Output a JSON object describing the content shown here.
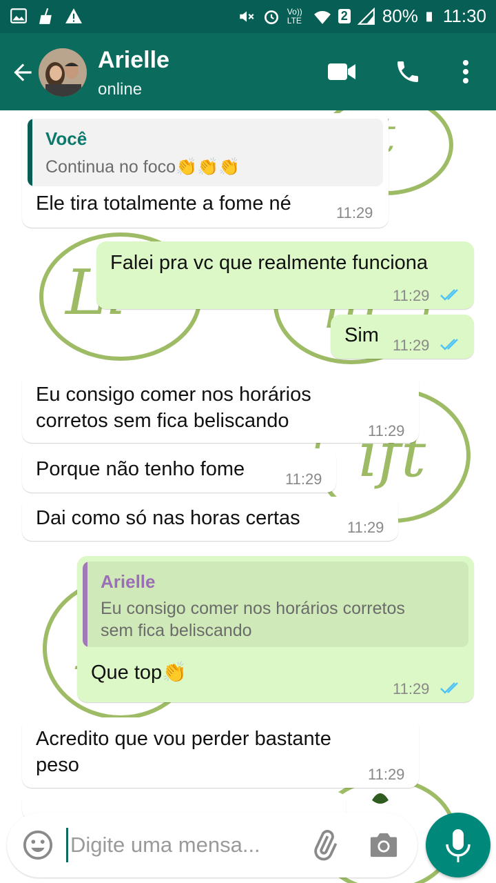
{
  "status_bar": {
    "battery": "80%",
    "time": "11:30",
    "carrier_label": "Vo)) LTE",
    "sim_badge": "2",
    "left_icons": [
      "image-icon",
      "broom-icon",
      "warning-icon"
    ],
    "right_icons": [
      "mute-icon",
      "alarm-icon",
      "wifi-icon",
      "signal-icon",
      "battery-icon"
    ]
  },
  "header": {
    "contact_name": "Arielle",
    "status": "online",
    "icons": [
      "back-arrow-icon",
      "video-call-icon",
      "phone-icon",
      "more-vert-icon"
    ]
  },
  "messages": [
    {
      "direction": "in",
      "quote": {
        "author": "Você",
        "text": "Continua no foco👏👏👏"
      },
      "lines": [
        "Ele tira totalmente a fome né"
      ],
      "time": "11:29"
    },
    {
      "direction": "out",
      "lines": [
        "Falei pra vc que realmente funciona"
      ],
      "time": "11:29",
      "status": "read"
    },
    {
      "direction": "out",
      "lines": [
        "Sim"
      ],
      "time": "11:29",
      "status": "read"
    },
    {
      "direction": "in",
      "lines": [
        "Eu consigo comer nos horários",
        "corretos sem fica beliscando"
      ],
      "time": "11:29"
    },
    {
      "direction": "in",
      "lines": [
        "Porque não tenho fome"
      ],
      "time": "11:29"
    },
    {
      "direction": "in",
      "lines": [
        "Dai como só nas horas certas"
      ],
      "time": "11:29"
    },
    {
      "direction": "out",
      "quote": {
        "author": "Arielle",
        "text_lines": [
          "Eu consigo comer nos horários corretos",
          "sem fica beliscando"
        ]
      },
      "lines": [
        "Que top👏"
      ],
      "time": "11:29",
      "status": "read"
    },
    {
      "direction": "in",
      "lines": [
        "Acredito que vou perder bastante",
        "peso"
      ],
      "time": "11:29"
    }
  ],
  "composer": {
    "placeholder": "Digite uma mensa...",
    "icons": [
      "emoji-icon",
      "attach-icon",
      "camera-icon",
      "mic-icon"
    ]
  },
  "colors": {
    "header": "#075e54",
    "outgoing_bubble": "#dcf8c6",
    "incoming_bubble": "#ffffff",
    "read_ticks": "#4fc3f7",
    "accent": "#00897b",
    "wallpaper_logo": "#8db04b"
  }
}
